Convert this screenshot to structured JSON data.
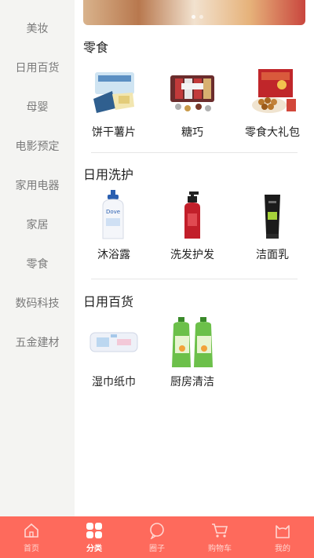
{
  "sidebar": {
    "items": [
      {
        "label": "美妆"
      },
      {
        "label": "日用百货"
      },
      {
        "label": "母婴"
      },
      {
        "label": "电影预定"
      },
      {
        "label": "家用电器"
      },
      {
        "label": "家居"
      },
      {
        "label": "零食"
      },
      {
        "label": "数码科技"
      },
      {
        "label": "五金建材"
      }
    ]
  },
  "sections": [
    {
      "title": "零食",
      "products": [
        {
          "label": "饼干薯片",
          "icon": "biscuit-box-icon"
        },
        {
          "label": "糖巧",
          "icon": "chocolate-kisses-icon"
        },
        {
          "label": "零食大礼包",
          "icon": "gift-box-nuts-icon"
        }
      ]
    },
    {
      "title": "日用洗护",
      "products": [
        {
          "label": "沐浴露",
          "icon": "body-wash-bottle-icon"
        },
        {
          "label": "洗发护发",
          "icon": "shampoo-bottle-icon"
        },
        {
          "label": "洁面乳",
          "icon": "facial-cleanser-tube-icon"
        }
      ]
    },
    {
      "title": "日用百货",
      "products": [
        {
          "label": "湿巾纸巾",
          "icon": "wet-wipes-pack-icon"
        },
        {
          "label": "厨房清洁",
          "icon": "dish-soap-bottles-icon"
        }
      ]
    }
  ],
  "tabbar": {
    "accent": "#fe6a5c",
    "tabs": [
      {
        "label": "首页",
        "icon": "home-icon"
      },
      {
        "label": "分类",
        "icon": "category-grid-icon"
      },
      {
        "label": "圈子",
        "icon": "chat-bubble-icon"
      },
      {
        "label": "购物车",
        "icon": "cart-icon"
      },
      {
        "label": "我的",
        "icon": "cat-face-icon"
      }
    ]
  }
}
